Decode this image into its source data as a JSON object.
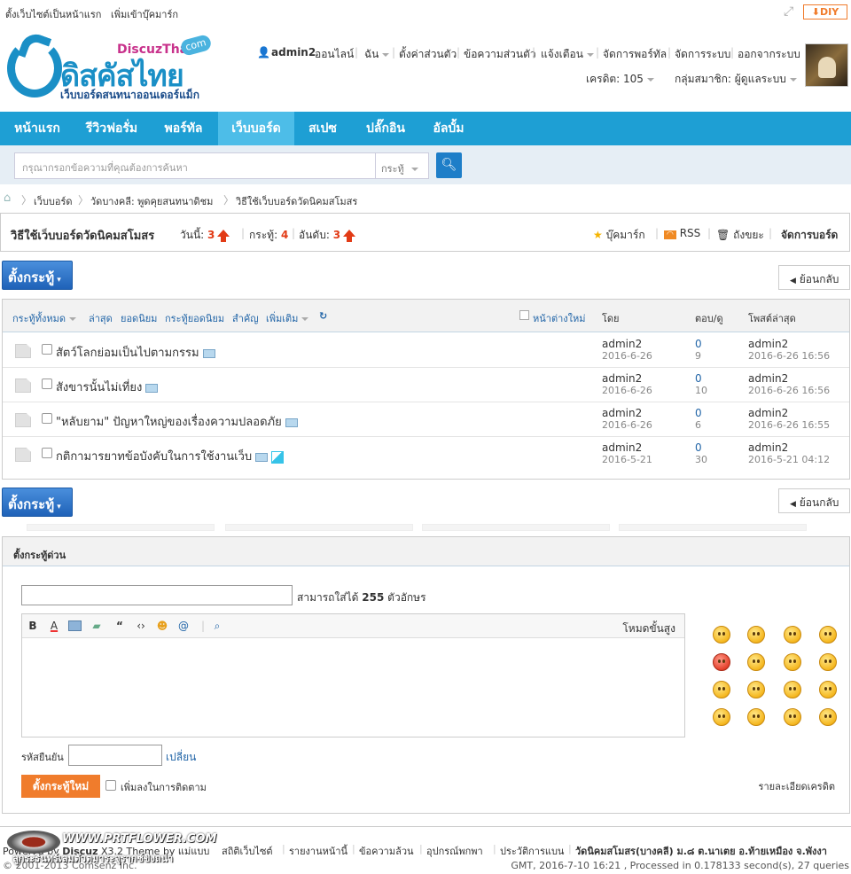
{
  "topbar": {
    "set_homepage": "ตั้งเว็บไซต์เป็นหน้าแรก",
    "bookmark": "เพิ่มเข้าบุ๊คมาร์ก",
    "diy": "DIY"
  },
  "logo": {
    "brand": "ดิสคัสไทย",
    "discuz": "DiscuzThai",
    "com": "com",
    "tagline": "เว็บบอร์ดสนทนาออนเดอร์แม็ก"
  },
  "user": {
    "name": "admin2",
    "online": "ออนไลน์",
    "menu": [
      "ฉัน",
      "ตั้งค่าส่วนตัว",
      "ข้อความส่วนตัว",
      "แจ้งเตือน",
      "จัดการพอร์ทัล",
      "จัดการระบบ",
      "ออกจากระบบ"
    ],
    "credit": "เครดิต: 105",
    "group": "กลุ่มสมาชิก: ผู้ดูแลระบบ"
  },
  "nav": [
    "หน้าแรก",
    "รีวิวฟอรั่ม",
    "พอร์ทัล",
    "เว็บบอร์ด",
    "สเปซ",
    "ปลั๊กอิน",
    "อัลบั้ม"
  ],
  "search": {
    "placeholder": "กรุณากรอกข้อความที่คุณต้องการค้นหา",
    "type": "กระทู้"
  },
  "breadcrumb": [
    "เว็บบอร์ด",
    "วัดบางคลี: พูดคุยสนทนาดิชม",
    "วิธีใช้เว็บบอร์ดวัดนิคมสโมสร"
  ],
  "forum": {
    "title": "วิธีใช้เว็บบอร์ดวัดนิคมสโมสร",
    "today_label": "วันนี้:",
    "today": "3",
    "threads_label": "กระทู้:",
    "threads": "4",
    "rank_label": "อันดับ:",
    "rank": "3",
    "bookmark": "บุ๊คมาร์ก",
    "rss": "RSS",
    "trash": "ถังขยะ",
    "manage": "จัดการบอร์ด"
  },
  "buttons": {
    "new_thread": "ตั้งกระทู้",
    "back": "ย้อนกลับ"
  },
  "filters": {
    "all": "กระทู้ทั้งหมด",
    "latest": "ล่าสุด",
    "hot": "ยอดนิยม",
    "top": "กระทู้ยอดนิยม",
    "digest": "สำคัญ",
    "more": "เพิ่มเติม",
    "new_window": "หน้าต่างใหม่",
    "col_by": "โดย",
    "col_replies": "ตอบ/ดู",
    "col_last": "โพสต์ล่าสุด"
  },
  "threads": [
    {
      "title": "สัตว์โลกย่อมเป็นไปตามกรรม",
      "author": "admin2",
      "date": "2016-6-26",
      "replies": "0",
      "views": "9",
      "last_user": "admin2",
      "last_time": "2016-6-26 16:56"
    },
    {
      "title": "สังขารนั้นไม่เที่ยง",
      "author": "admin2",
      "date": "2016-6-26",
      "replies": "0",
      "views": "10",
      "last_user": "admin2",
      "last_time": "2016-6-26 16:56"
    },
    {
      "title": "\"หลับยาม\" ปัญหาใหญ่ของเรื่องความปลอดภัย",
      "author": "admin2",
      "date": "2016-6-26",
      "replies": "0",
      "views": "6",
      "last_user": "admin2",
      "last_time": "2016-6-26 16:55"
    },
    {
      "title": "กติกามารยาทข้อบังคับในการใช้งานเว็บ",
      "author": "admin2",
      "date": "2016-5-21",
      "replies": "0",
      "views": "30",
      "last_user": "admin2",
      "last_time": "2016-5-21 04:12"
    }
  ],
  "quickpost": {
    "title": "ตั้งกระทู้ด่วน",
    "limit_prefix": "สามารถใส่ได้",
    "limit": "255",
    "limit_suffix": "ตัวอักษร",
    "advanced": "โหมดขั้นสูง",
    "captcha": "รหัสยืนยัน",
    "change": "เปลี่ยน",
    "submit": "ตั้งกระทู้ใหม่",
    "follow": "เพิ่มลงในการติดตาม",
    "credit_detail": "รายละเอียดเครดิต"
  },
  "footer": {
    "powered_prefix": "Powered by",
    "powered": "Discuz",
    "version": "X3.2",
    "theme": "Theme by แม่แบบ",
    "copyright": "© 2001-2013 Comsenz Inc.",
    "links": [
      "สถิติเว็บไซต์",
      "รายงานหน้านี้",
      "ข้อความล้วน",
      "อุปกรณ์พกพา",
      "ประวัติการแบน"
    ],
    "address": "วัดนิคมสโมสร(บางคลี) ม.๘ ต.นาเตย อ.ท้ายเหมือง จ.พังงา",
    "stats": "GMT, 2016-7-10 16:21 , Processed in 0.178133 second(s), 27 queries",
    "watermark": "WWW.PRTFLOWER.COM",
    "watermark2": "ลูกระรินทร์เลมตัวตมาระจุรากซ์ขิงถน่า"
  }
}
